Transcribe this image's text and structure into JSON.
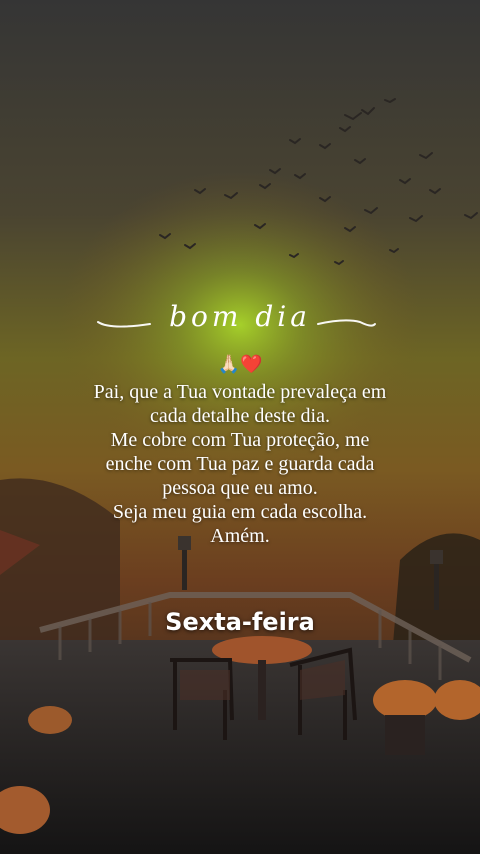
{
  "greeting": "bom dia",
  "emoji": "🙏🏻❤️",
  "message_lines": [
    "Pai, que a Tua vontade prevaleça em",
    "cada detalhe deste dia.",
    "Me cobre com Tua proteção, me",
    "enche com Tua paz e guarda cada",
    "pessoa que eu amo.",
    "Seja meu guia em cada escolha.",
    "Amém."
  ],
  "day_label": "Sexta-feira",
  "colors": {
    "sky_top": "#3a3a3a",
    "sky_mid": "#6b5a2a",
    "sun_glow": "#8fbf2a",
    "horizon": "#b8661e",
    "text": "#ffffff"
  }
}
